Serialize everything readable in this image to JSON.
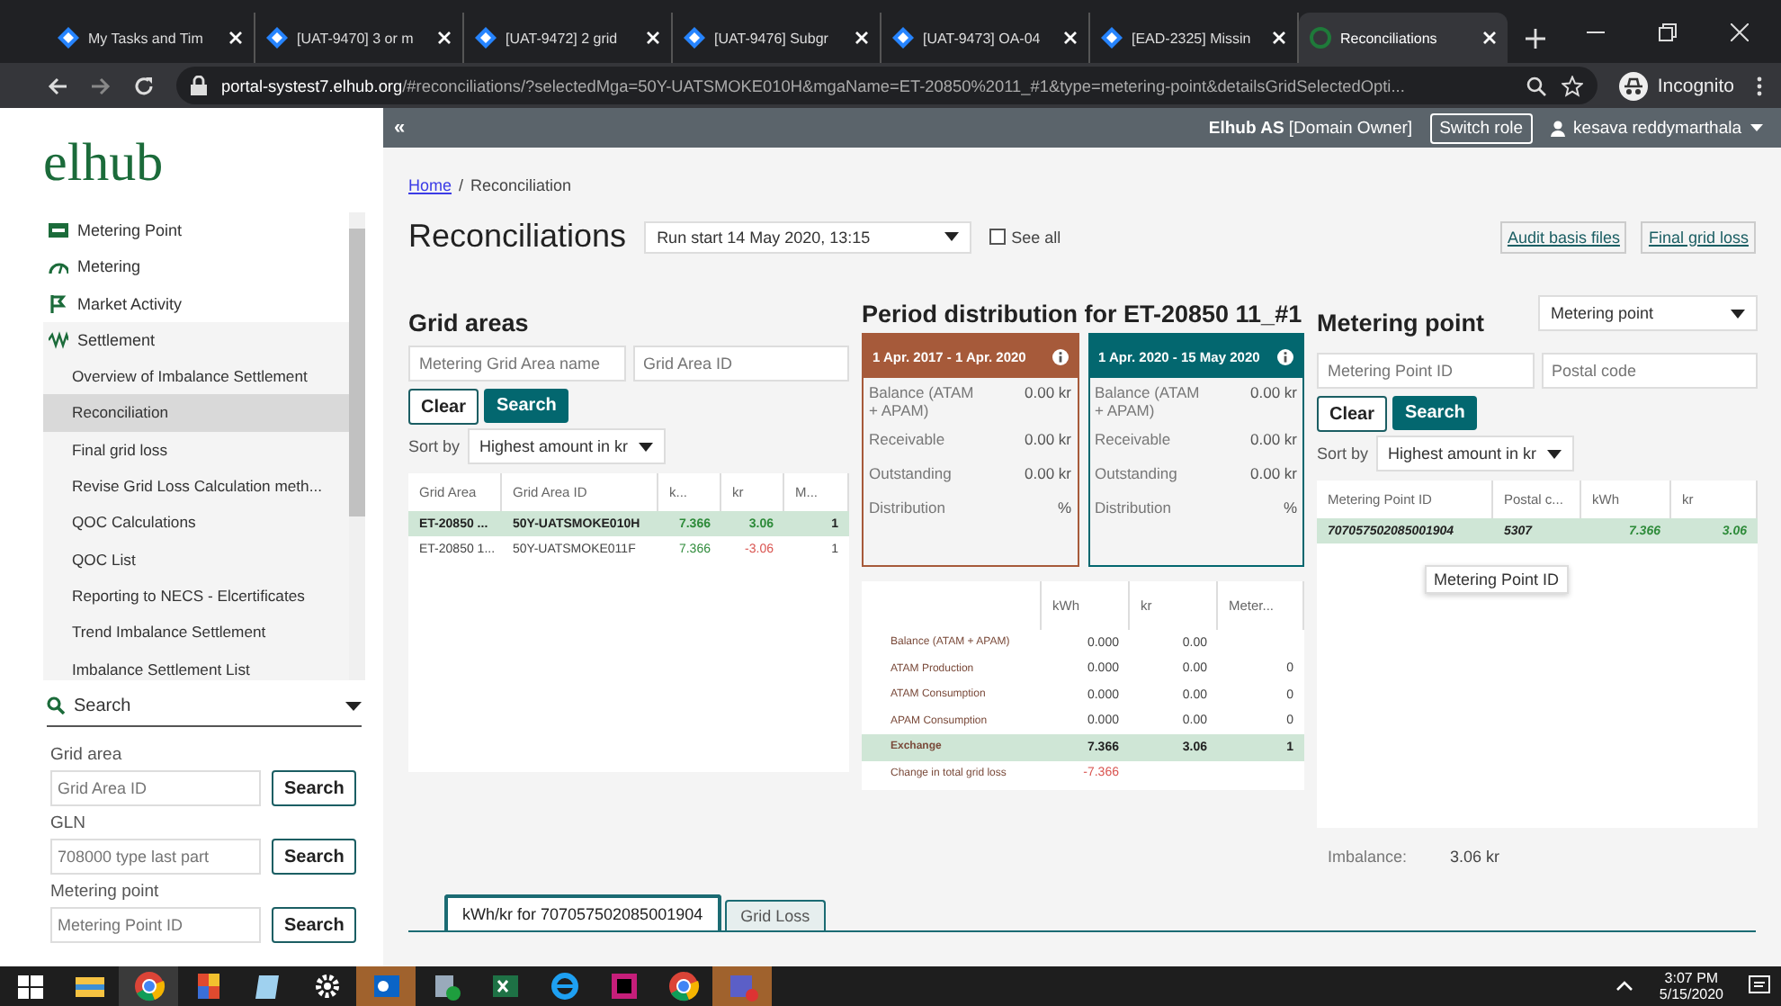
{
  "browser": {
    "tabs": [
      {
        "title": "My Tasks and Tim",
        "kind": "jira",
        "selected": false
      },
      {
        "title": "[UAT-9470] 3 or m",
        "kind": "jira",
        "selected": false
      },
      {
        "title": "[UAT-9472] 2 grid",
        "kind": "jira",
        "selected": false
      },
      {
        "title": "[UAT-9476] Subgr",
        "kind": "jira",
        "selected": false
      },
      {
        "title": "[UAT-9473] OA-04",
        "kind": "jira",
        "selected": false
      },
      {
        "title": "[EAD-2325] Missin",
        "kind": "jira",
        "selected": false
      },
      {
        "title": "Reconciliations",
        "kind": "elhub",
        "selected": true
      }
    ],
    "url_host": "portal-systest7.elhub.org",
    "url_path": "/#reconciliations/?selectedMga=50Y-UATSMOKE010H&mgaName=ET-20850%2011_#1&type=metering-point&detailsGridSelectedOpti...",
    "profile": "Incognito"
  },
  "header": {
    "collapse": "«",
    "org": "Elhub AS",
    "role": "[Domain Owner]",
    "switch_role": "Switch role",
    "user": "kesava reddymarthala"
  },
  "sidebar": {
    "logo": "elhub",
    "nav": [
      {
        "label": "Metering Point",
        "kind": "card"
      },
      {
        "label": "Metering",
        "kind": "gauge"
      },
      {
        "label": "Market Activity",
        "kind": "flag"
      },
      {
        "label": "Settlement",
        "kind": "wave",
        "children": [
          {
            "label": "Overview of Imbalance Settlement",
            "selected": false
          },
          {
            "label": "Reconciliation",
            "selected": true
          },
          {
            "label": "Final grid loss",
            "selected": false
          },
          {
            "label": "Revise Grid Loss Calculation meth...",
            "selected": false
          },
          {
            "label": "QOC Calculations",
            "selected": false
          },
          {
            "label": "QOC List",
            "selected": false
          },
          {
            "label": "Reporting to NECS - Elcertificates",
            "selected": false
          },
          {
            "label": "Trend Imbalance Settlement",
            "selected": false
          },
          {
            "label": "Imbalance Settlement List",
            "selected": false
          }
        ]
      }
    ],
    "search": {
      "label": "Search"
    },
    "search_groups": [
      {
        "label": "Grid area",
        "placeholder": "Grid Area ID",
        "button": "Search"
      },
      {
        "label": "GLN",
        "placeholder": "708000 type last part",
        "button": "Search"
      },
      {
        "label": "Metering point",
        "placeholder": "Metering Point ID",
        "button": "Search"
      }
    ]
  },
  "breadcrumb": [
    {
      "label": "Home",
      "link": true
    },
    {
      "separator": "/",
      "label": "Reconciliation",
      "link": false
    }
  ],
  "page_title": "Reconciliations",
  "run_select": "Run start 14 May 2020, 13:15",
  "see_all": {
    "label": "See all",
    "checked": false
  },
  "links": [
    "Audit basis files",
    "Final grid loss"
  ],
  "grid_areas": {
    "title": "Grid areas",
    "filters": [
      {
        "placeholder": "Metering Grid Area name"
      },
      {
        "placeholder": "Grid Area ID"
      }
    ],
    "clear": "Clear",
    "search": "Search",
    "sort_label": "Sort by",
    "sort_value": "Highest amount in kr",
    "columns": [
      "Grid Area",
      "Grid Area ID",
      "k...",
      "kr",
      "M..."
    ],
    "rows": [
      {
        "selected": true,
        "cells": [
          {
            "text": "ET-20850 ..."
          },
          {
            "text": "50Y-UATSMOKE010H"
          },
          {
            "text": "7.366",
            "color": "#2e8b3a"
          },
          {
            "text": "3.06",
            "color": "#2e8b3a"
          },
          {
            "text": "1"
          }
        ]
      },
      {
        "selected": false,
        "cells": [
          {
            "text": "ET-20850 1..."
          },
          {
            "text": "50Y-UATSMOKE011F"
          },
          {
            "text": "7.366",
            "color": "#2e8b3a"
          },
          {
            "text": "-3.06",
            "color": "#d9534f"
          },
          {
            "text": "1"
          }
        ]
      }
    ]
  },
  "period": {
    "title": "Period distribution for ET-20850 11_#1",
    "cards": [
      {
        "period": "1 Apr. 2017 - 1 Apr. 2020",
        "color": "#a65a3a",
        "rows": [
          {
            "label": "Balance (ATAM + APAM)",
            "value": "0.00 kr"
          },
          {
            "label": "Receivable",
            "value": "0.00 kr"
          },
          {
            "label": "Outstanding",
            "value": "0.00 kr"
          },
          {
            "label": "Distribution",
            "value": "%"
          }
        ]
      },
      {
        "period": "1 Apr. 2020 - 15 May 2020",
        "color": "#03676f",
        "rows": [
          {
            "label": "Balance (ATAM + APAM)",
            "value": "0.00 kr"
          },
          {
            "label": "Receivable",
            "value": "0.00 kr"
          },
          {
            "label": "Outstanding",
            "value": "0.00 kr"
          },
          {
            "label": "Distribution",
            "value": "%"
          }
        ]
      }
    ],
    "columns": [
      "",
      "kWh",
      "kr",
      "Meter..."
    ],
    "rows": [
      {
        "selected": false,
        "cells": [
          {
            "text": "Balance (ATAM + APAM)"
          },
          {
            "text": "0.000"
          },
          {
            "text": "0.00"
          },
          {
            "text": ""
          }
        ]
      },
      {
        "selected": false,
        "cells": [
          {
            "text": "ATAM Production"
          },
          {
            "text": "0.000"
          },
          {
            "text": "0.00"
          },
          {
            "text": "0"
          }
        ]
      },
      {
        "selected": false,
        "cells": [
          {
            "text": "ATAM Consumption"
          },
          {
            "text": "0.000"
          },
          {
            "text": "0.00"
          },
          {
            "text": "0"
          }
        ]
      },
      {
        "selected": false,
        "cells": [
          {
            "text": "APAM Consumption"
          },
          {
            "text": "0.000"
          },
          {
            "text": "0.00"
          },
          {
            "text": "0"
          }
        ]
      },
      {
        "selected": true,
        "cells": [
          {
            "text": "Exchange"
          },
          {
            "text": "7.366"
          },
          {
            "text": "3.06"
          },
          {
            "text": "1"
          }
        ]
      },
      {
        "selected": false,
        "cells": [
          {
            "text": "Change in total grid loss"
          },
          {
            "text": "-7.366",
            "color": "#d9534f"
          }
        ]
      }
    ]
  },
  "metering": {
    "title": "Metering point",
    "type_select": "Metering point",
    "filters": [
      {
        "placeholder": "Metering Point ID"
      },
      {
        "placeholder": "Postal code"
      }
    ],
    "clear": "Clear",
    "search": "Search",
    "sort_label": "Sort by",
    "sort_value": "Highest amount in kr",
    "columns": [
      "Metering Point ID",
      "Postal c...",
      "kWh",
      "kr"
    ],
    "rows": [
      {
        "selected": true,
        "cells": [
          {
            "text": "707057502085001904"
          },
          {
            "text": "5307"
          },
          {
            "text": "7.366",
            "color": "#2e8b3a"
          },
          {
            "text": "3.06",
            "color": "#2e8b3a"
          }
        ]
      }
    ],
    "tooltip": "Metering Point ID",
    "imbalance_label": "Imbalance:",
    "imbalance_value": "3.06 kr"
  },
  "bottom_tabs": [
    {
      "label": "kWh/kr for 707057502085001904",
      "selected": true
    },
    {
      "label": "Grid Loss",
      "selected": false
    }
  ],
  "taskbar": {
    "time": "3:07 PM",
    "date": "5/15/2020"
  }
}
